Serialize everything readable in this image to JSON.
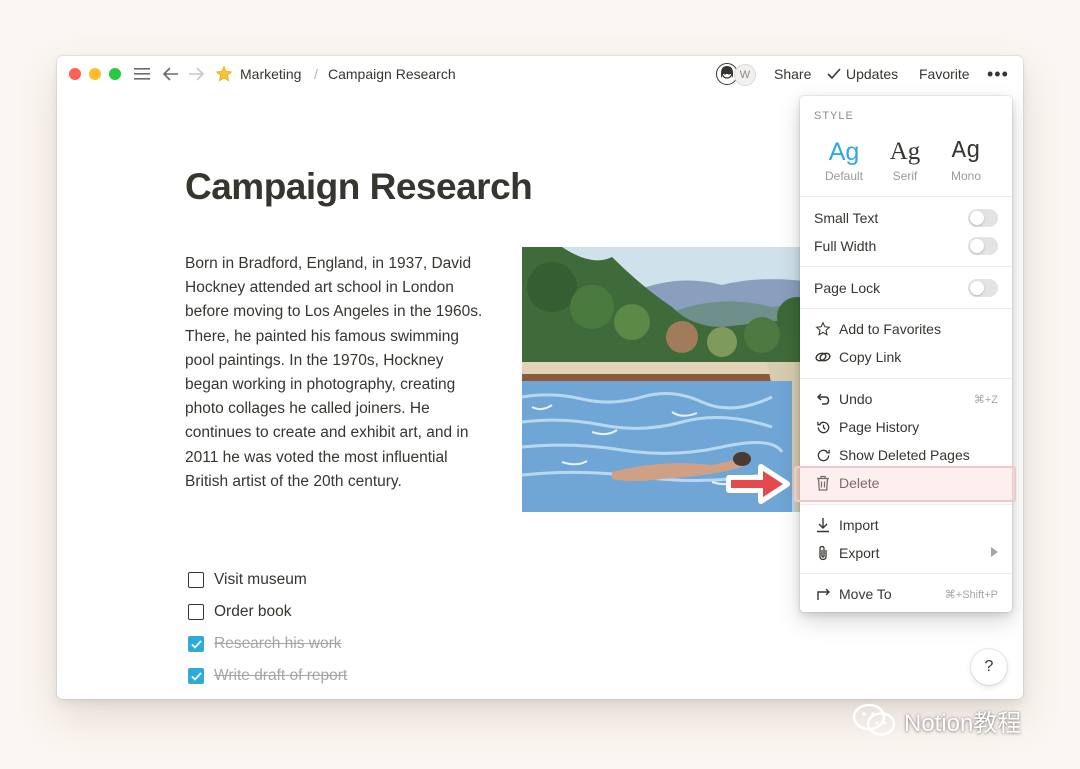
{
  "breadcrumb": {
    "icon": "star-emoji",
    "parent": "Marketing",
    "separator": "/",
    "current": "Campaign Research"
  },
  "topbar": {
    "avatar_initial": "W",
    "share": "Share",
    "updates": "Updates",
    "favorite": "Favorite",
    "more": "•••"
  },
  "page": {
    "title": "Campaign Research",
    "paragraph": "Born in Bradford, England, in 1937, David Hockney attended art school in London before moving to Los Angeles in the 1960s. There, he painted his famous swimming pool paintings. In the 1970s, Hockney began working in photography, creating photo collages he called joiners. He continues to create and exhibit art, and in 2011 he was voted the most influential British artist of the 20th century.",
    "todos": [
      {
        "label": "Visit museum",
        "checked": false
      },
      {
        "label": "Order book",
        "checked": false
      },
      {
        "label": "Research his work",
        "checked": true
      },
      {
        "label": "Write draft of report",
        "checked": true
      }
    ]
  },
  "menu": {
    "style_label": "STYLE",
    "styles": [
      {
        "glyph": "Ag",
        "caption": "Default",
        "selected": true
      },
      {
        "glyph": "Ag",
        "caption": "Serif",
        "selected": false
      },
      {
        "glyph": "Ag",
        "caption": "Mono",
        "selected": false
      }
    ],
    "toggles": {
      "small_text": "Small Text",
      "full_width": "Full Width",
      "page_lock": "Page Lock"
    },
    "items": {
      "add_to_favorites": "Add to Favorites",
      "copy_link": "Copy Link",
      "undo": "Undo",
      "undo_shortcut": "⌘+Z",
      "page_history": "Page History",
      "show_deleted": "Show Deleted Pages",
      "delete": "Delete",
      "import": "Import",
      "export": "Export",
      "move_to": "Move To",
      "move_to_shortcut": "⌘+Shift+P"
    }
  },
  "help": "?",
  "watermark": "Notion教程",
  "colors": {
    "accent": "#2eaadc",
    "highlight_border": "#f3c8c8",
    "arrow": "#e5484d"
  }
}
